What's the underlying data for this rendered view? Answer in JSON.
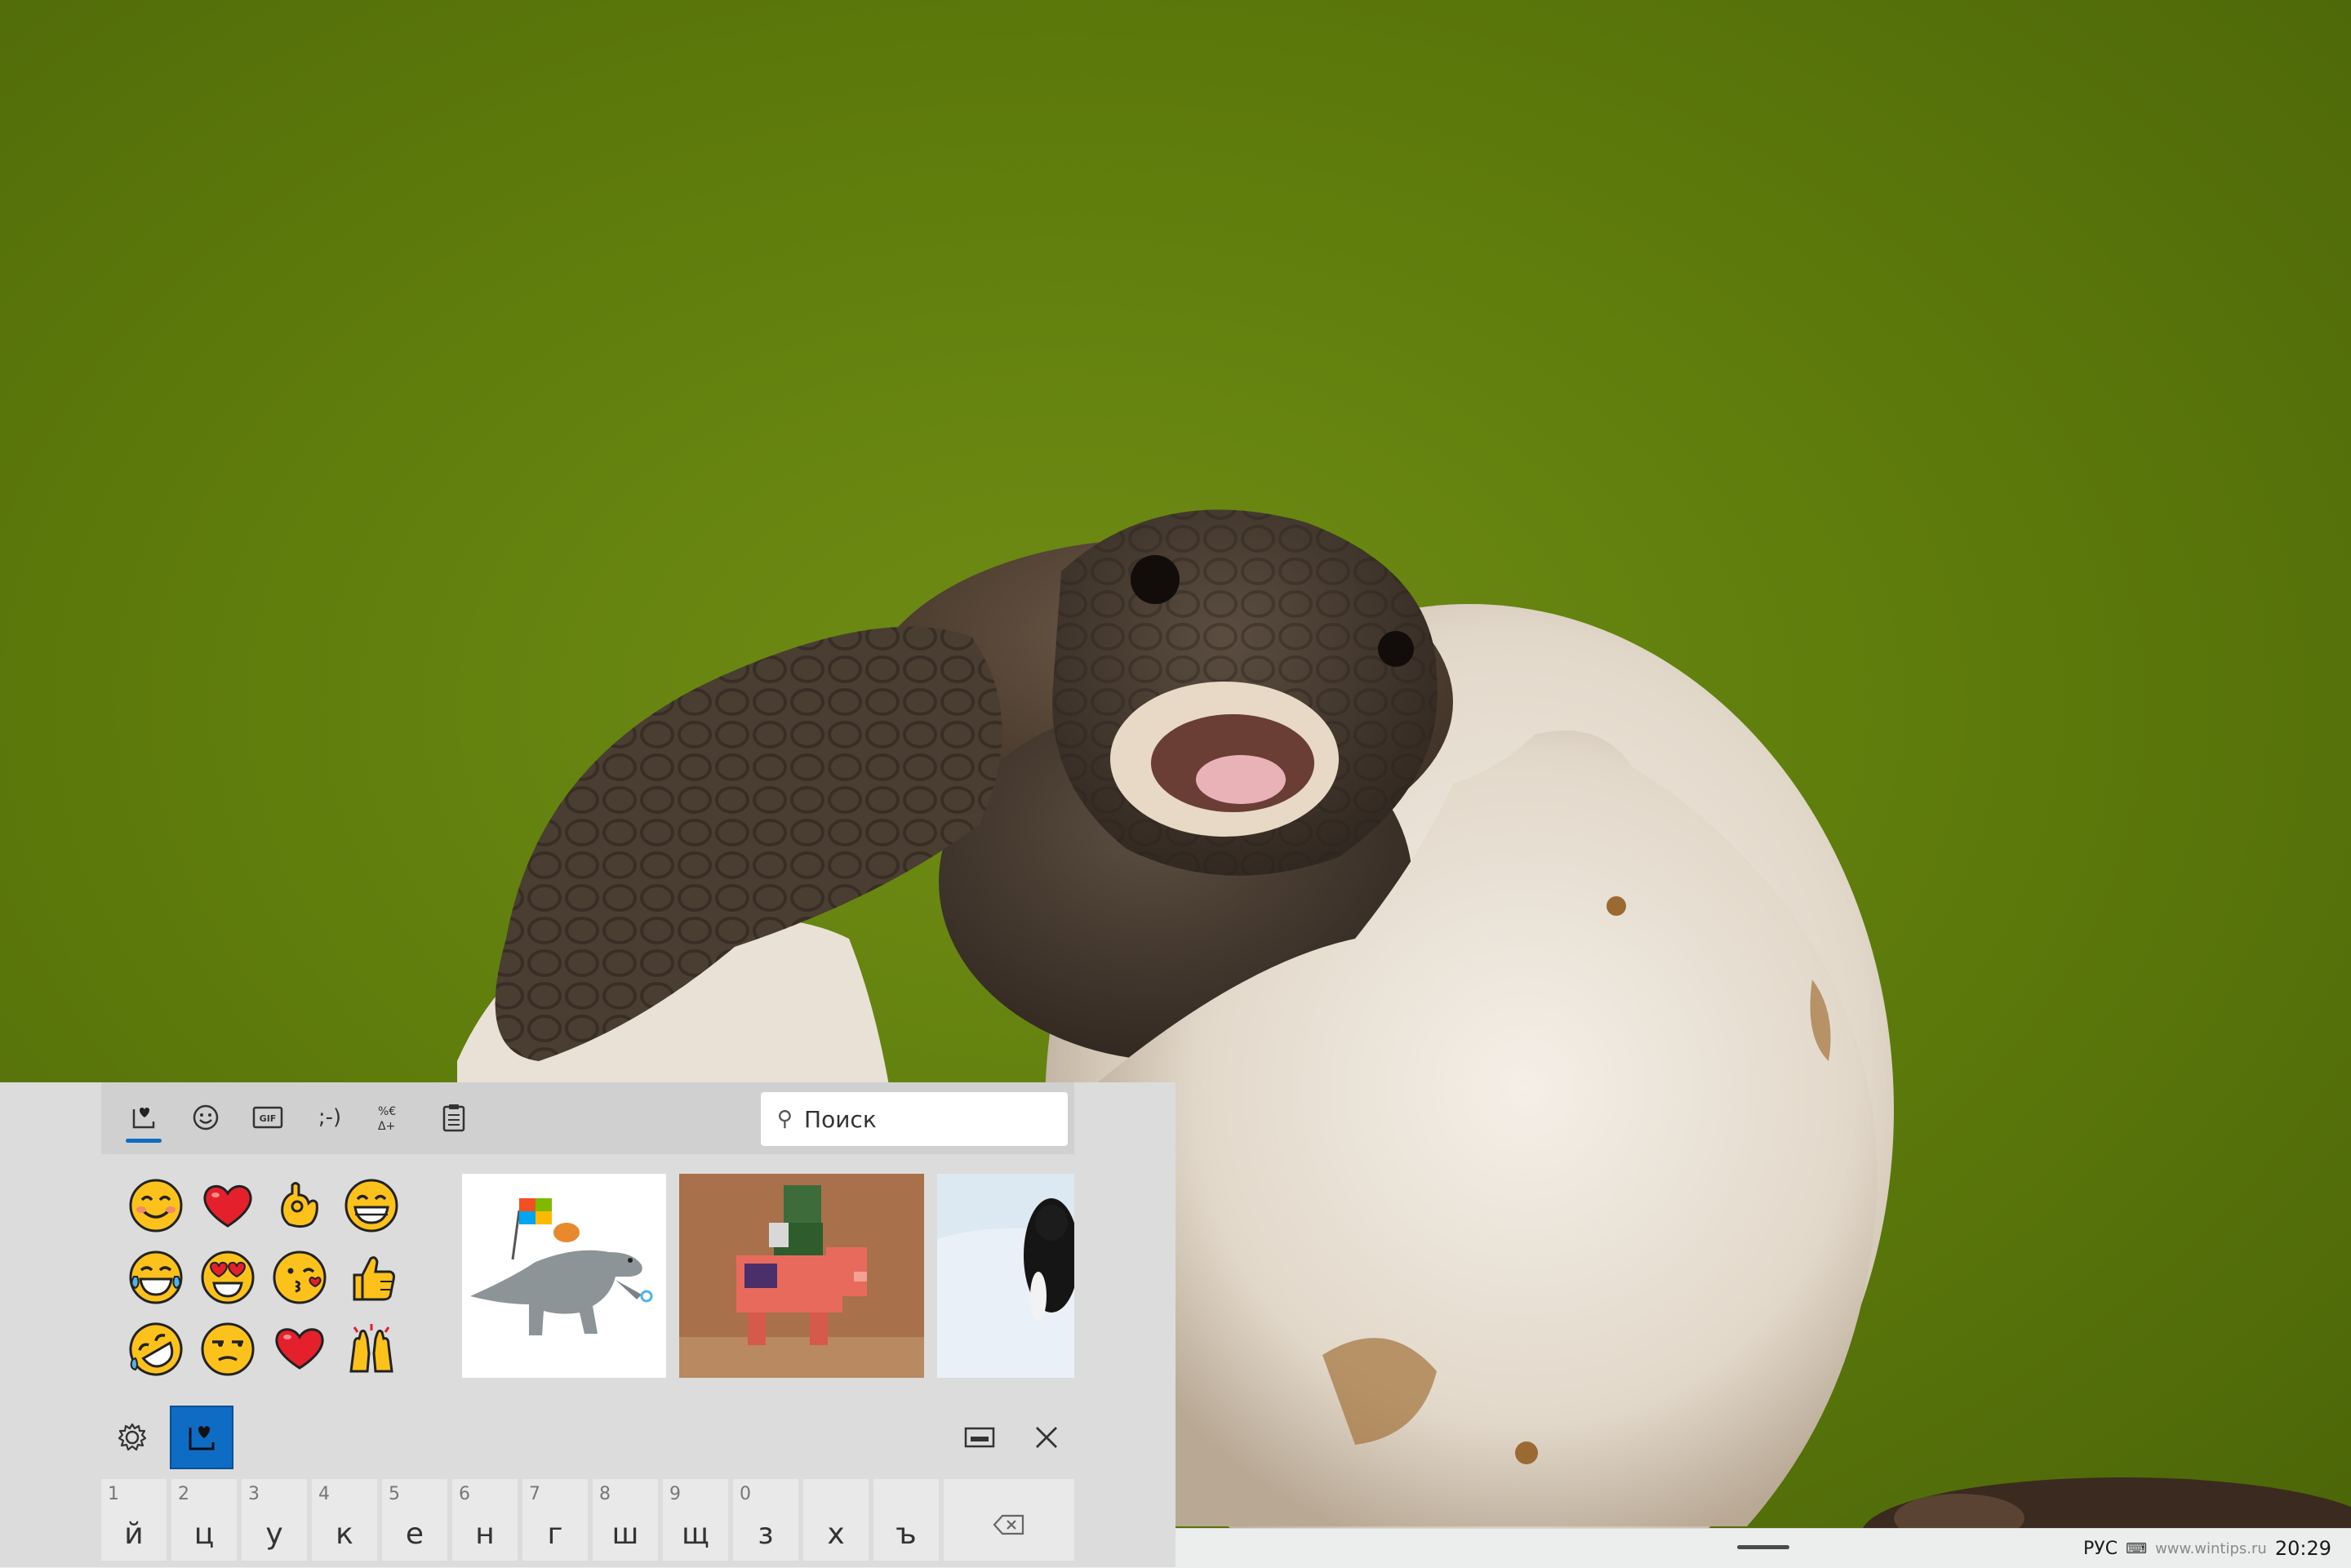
{
  "keyboard": {
    "tabs": [
      {
        "name": "favorites",
        "icon": "favorites-heart-icon"
      },
      {
        "name": "emoji",
        "icon": "smiley-icon"
      },
      {
        "name": "gif",
        "icon": "gif-icon"
      },
      {
        "name": "kaomoji",
        "icon": "kaomoji-icon",
        "label": ";-)"
      },
      {
        "name": "symbols",
        "icon": "symbols-icon",
        "label": "%€\nΔ+"
      },
      {
        "name": "clipboard",
        "icon": "clipboard-icon"
      }
    ],
    "search": {
      "placeholder": "Поиск"
    },
    "emojis": [
      "😊",
      "❤️",
      "👌",
      "😁",
      "😂",
      "😍",
      "😘",
      "👍",
      "🤣",
      "😒",
      "❤️",
      "🙌"
    ],
    "gifs": [
      {
        "name": "dinosaur-windows-flag-gif"
      },
      {
        "name": "minecraft-pig-rider-gif"
      },
      {
        "name": "penguin-snow-gif"
      }
    ],
    "keys": [
      {
        "num": "1",
        "char": "й"
      },
      {
        "num": "2",
        "char": "ц"
      },
      {
        "num": "3",
        "char": "у"
      },
      {
        "num": "4",
        "char": "к"
      },
      {
        "num": "5",
        "char": "е"
      },
      {
        "num": "6",
        "char": "н"
      },
      {
        "num": "7",
        "char": "г"
      },
      {
        "num": "8",
        "char": "ш"
      },
      {
        "num": "9",
        "char": "щ"
      },
      {
        "num": "0",
        "char": "з"
      },
      {
        "num": "",
        "char": "х"
      },
      {
        "num": "",
        "char": "ъ"
      }
    ],
    "backspace_icon": "backspace-icon",
    "accent_color": "#0f6cc4"
  },
  "taskbar": {
    "language": "РУС",
    "watermark": "www.wintips.ru",
    "clock": "20:29"
  }
}
